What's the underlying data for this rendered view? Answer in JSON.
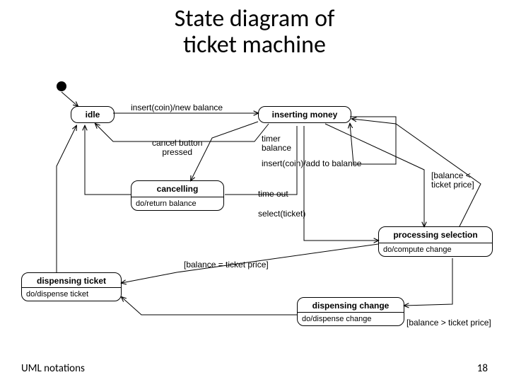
{
  "title_line1": "State diagram of",
  "title_line2": "ticket machine",
  "footer_left": "UML notations",
  "footer_right": "18",
  "states": {
    "idle": {
      "name": "idle"
    },
    "inserting_money": {
      "name": "inserting money"
    },
    "cancelling": {
      "name": "cancelling",
      "activity": "do/return balance"
    },
    "processing_selection": {
      "name": "processing selection",
      "activity": "do/compute change"
    },
    "dispensing_ticket": {
      "name": "dispensing ticket",
      "activity": "do/dispense ticket"
    },
    "dispensing_change": {
      "name": "dispensing change",
      "activity": "do/dispense change"
    }
  },
  "transitions": {
    "insert_new_balance": "insert(coin)/new balance",
    "cancel_pressed_l1": "cancel button",
    "cancel_pressed_l2": "pressed",
    "timer_l1": "timer",
    "timer_l2": "balance",
    "insert_add": "insert(coin)/add to balance",
    "balance_lt_l1": "[balance <",
    "balance_lt_l2": "ticket price]",
    "time_out": "time out",
    "select_ticket": "select(ticket)",
    "balance_eq": "[balance = ticket price]",
    "balance_gt": "[balance > ticket price]"
  }
}
